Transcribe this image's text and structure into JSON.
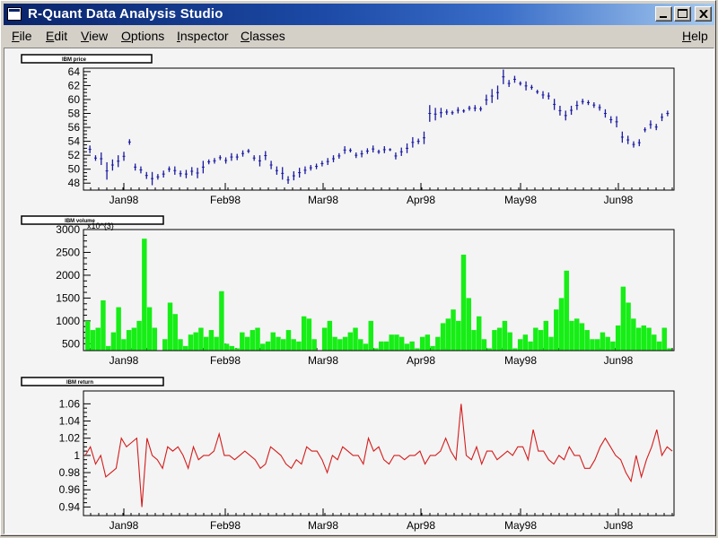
{
  "window": {
    "title": "R-Quant Data Analysis Studio",
    "menu": [
      {
        "name": "File",
        "accel": "F",
        "rest": "ile"
      },
      {
        "name": "Edit",
        "accel": "E",
        "rest": "dit"
      },
      {
        "name": "View",
        "accel": "V",
        "rest": "iew"
      },
      {
        "name": "Options",
        "accel": "O",
        "rest": "ptions"
      },
      {
        "name": "Inspector",
        "accel": "I",
        "rest": "nspector"
      },
      {
        "name": "Classes",
        "accel": "C",
        "rest": "lasses"
      }
    ],
    "help": {
      "accel": "H",
      "rest": "elp"
    }
  },
  "chart_data": [
    {
      "type": "ohlc",
      "title": "IBM price",
      "x_tick_labels": [
        "Jan98",
        "Feb98",
        "Mar98",
        "Apr98",
        "May98",
        "Jun98"
      ],
      "ylim": [
        47,
        64.5
      ],
      "y_ticks": [
        48,
        50,
        52,
        54,
        56,
        58,
        60,
        62,
        64
      ],
      "color": "#1a1aa0",
      "values": [
        [
          52.3,
          53.4
        ],
        [
          51.2,
          52.0
        ],
        [
          50.6,
          52.4
        ],
        [
          48.5,
          51.0
        ],
        [
          49.8,
          51.4
        ],
        [
          50.3,
          52.0
        ],
        [
          51.2,
          52.5
        ],
        [
          53.5,
          54.3
        ],
        [
          49.8,
          50.8
        ],
        [
          49.4,
          50.4
        ],
        [
          48.6,
          49.6
        ],
        [
          47.7,
          49.6
        ],
        [
          48.5,
          49.3
        ],
        [
          48.8,
          49.8
        ],
        [
          49.6,
          50.4
        ],
        [
          49.2,
          50.4
        ],
        [
          48.9,
          49.8
        ],
        [
          48.7,
          49.9
        ],
        [
          49.1,
          50.3
        ],
        [
          48.7,
          50.2
        ],
        [
          49.4,
          51.2
        ],
        [
          50.7,
          51.4
        ],
        [
          50.8,
          51.6
        ],
        [
          51.3,
          52.0
        ],
        [
          50.8,
          51.7
        ],
        [
          51.2,
          52.3
        ],
        [
          51.3,
          52.2
        ],
        [
          51.8,
          52.7
        ],
        [
          52.3,
          52.9
        ],
        [
          51.2,
          52.0
        ],
        [
          50.4,
          52.0
        ],
        [
          51.3,
          52.6
        ],
        [
          50.0,
          51.2
        ],
        [
          49.2,
          50.4
        ],
        [
          48.5,
          50.3
        ],
        [
          47.9,
          49.0
        ],
        [
          48.4,
          49.7
        ],
        [
          48.8,
          50.2
        ],
        [
          49.3,
          50.4
        ],
        [
          49.8,
          50.6
        ],
        [
          50.0,
          50.8
        ],
        [
          50.4,
          51.2
        ],
        [
          50.6,
          51.6
        ],
        [
          51.0,
          52.0
        ],
        [
          51.5,
          52.3
        ],
        [
          52.2,
          53.3
        ],
        [
          52.4,
          53.0
        ],
        [
          51.6,
          52.4
        ],
        [
          51.7,
          52.7
        ],
        [
          52.2,
          53.0
        ],
        [
          52.4,
          53.4
        ],
        [
          52.2,
          52.8
        ],
        [
          52.3,
          53.3
        ],
        [
          52.6,
          53.0
        ],
        [
          51.4,
          52.4
        ],
        [
          51.9,
          53.1
        ],
        [
          52.3,
          53.7
        ],
        [
          53.1,
          54.6
        ],
        [
          53.6,
          54.4
        ],
        [
          53.6,
          55.4
        ],
        [
          56.8,
          59.2
        ],
        [
          57.0,
          58.8
        ],
        [
          57.4,
          58.8
        ],
        [
          57.8,
          58.6
        ],
        [
          57.8,
          58.4
        ],
        [
          58.0,
          58.9
        ],
        [
          58.1,
          58.6
        ],
        [
          58.4,
          59.1
        ],
        [
          58.3,
          59.2
        ],
        [
          58.3,
          59.0
        ],
        [
          59.2,
          60.7
        ],
        [
          59.5,
          61.5
        ],
        [
          60.0,
          62.0
        ],
        [
          62.2,
          64.3
        ],
        [
          61.8,
          62.8
        ],
        [
          62.4,
          63.4
        ],
        [
          62.0,
          62.6
        ],
        [
          61.3,
          62.6
        ],
        [
          61.4,
          62.1
        ],
        [
          60.8,
          61.4
        ],
        [
          60.1,
          61.2
        ],
        [
          60.0,
          61.0
        ],
        [
          58.5,
          60.1
        ],
        [
          57.7,
          59.1
        ],
        [
          57.0,
          58.4
        ],
        [
          57.8,
          59.1
        ],
        [
          58.5,
          59.8
        ],
        [
          59.3,
          60.1
        ],
        [
          59.2,
          59.9
        ],
        [
          58.8,
          59.6
        ],
        [
          58.4,
          59.3
        ],
        [
          57.4,
          58.6
        ],
        [
          56.6,
          57.6
        ],
        [
          56.0,
          57.6
        ],
        [
          53.8,
          55.4
        ],
        [
          53.6,
          54.8
        ],
        [
          53.1,
          54.0
        ],
        [
          53.3,
          54.3
        ],
        [
          55.3,
          56.0
        ],
        [
          55.8,
          57.0
        ],
        [
          55.6,
          56.5
        ],
        [
          56.9,
          58.0
        ],
        [
          57.6,
          58.4
        ]
      ]
    },
    {
      "type": "bar",
      "title": "IBM volume",
      "axis_note": "x10^{3}",
      "x_tick_labels": [
        "Jan98",
        "Feb98",
        "Mar98",
        "Apr98",
        "May98",
        "Jun98"
      ],
      "ylim": [
        350,
        3000
      ],
      "y_ticks": [
        500,
        1000,
        1500,
        2000,
        2500,
        3000
      ],
      "color": "#16ee16",
      "values": [
        1000,
        800,
        850,
        1450,
        450,
        750,
        1300,
        600,
        800,
        850,
        1000,
        2800,
        1300,
        850,
        350,
        600,
        1400,
        1150,
        600,
        450,
        700,
        750,
        850,
        650,
        800,
        650,
        1650,
        500,
        450,
        400,
        750,
        650,
        800,
        850,
        500,
        550,
        750,
        650,
        600,
        800,
        600,
        550,
        1100,
        1050,
        600,
        350,
        850,
        1000,
        650,
        600,
        650,
        750,
        850,
        600,
        500,
        1000,
        400,
        550,
        550,
        700,
        700,
        650,
        500,
        550,
        400,
        650,
        700,
        450,
        650,
        950,
        1050,
        1250,
        1000,
        2450,
        1500,
        800,
        1100,
        600,
        400,
        800,
        850,
        1000,
        750,
        400,
        600,
        700,
        550,
        850,
        800,
        1000,
        650,
        1250,
        1500,
        2100,
        1000,
        1050,
        950,
        800,
        600,
        600,
        750,
        650,
        550,
        900,
        1750,
        1400,
        1050,
        850,
        900,
        850,
        700,
        550,
        850,
        400
      ]
    },
    {
      "type": "line",
      "title": "IBM return",
      "x_tick_labels": [
        "Jan98",
        "Feb98",
        "Mar98",
        "Apr98",
        "May98",
        "Jun98"
      ],
      "ylim": [
        0.93,
        1.075
      ],
      "y_ticks": [
        0.94,
        0.96,
        0.98,
        1,
        1.02,
        1.04,
        1.06
      ],
      "y_tick_labels": [
        "0.94",
        "0.96",
        "0.98",
        "1",
        "1.02",
        "1.04",
        "1.06"
      ],
      "color": "#d41c1c",
      "values": [
        1.0,
        1.01,
        0.99,
        1.0,
        0.975,
        0.98,
        0.985,
        1.02,
        1.01,
        1.015,
        1.02,
        0.94,
        1.02,
        1.0,
        0.995,
        0.985,
        1.01,
        1.005,
        1.01,
        1.0,
        0.985,
        1.01,
        0.995,
        1.0,
        1.0,
        1.005,
        1.025,
        1.0,
        1.0,
        0.995,
        1.0,
        1.005,
        1.0,
        0.995,
        0.985,
        0.99,
        1.01,
        1.005,
        1.0,
        0.99,
        0.985,
        0.995,
        0.99,
        1.01,
        1.005,
        1.005,
        0.995,
        0.98,
        1.0,
        0.995,
        1.01,
        1.005,
        1.0,
        1.0,
        0.99,
        1.02,
        1.005,
        1.01,
        0.995,
        0.99,
        1.0,
        1.0,
        0.995,
        1.0,
        1.0,
        1.005,
        0.99,
        1.0,
        1.0,
        1.005,
        1.02,
        1.005,
        0.995,
        1.06,
        1.0,
        0.995,
        1.01,
        0.99,
        1.005,
        1.005,
        0.995,
        1.0,
        1.005,
        1.0,
        1.01,
        1.01,
        0.995,
        1.03,
        1.005,
        1.005,
        0.995,
        0.99,
        1.0,
        0.995,
        1.01,
        1.0,
        1.0,
        0.985,
        0.985,
        0.995,
        1.01,
        1.02,
        1.01,
        1.0,
        0.995,
        0.98,
        0.97,
        1.0,
        0.975,
        0.995,
        1.01,
        1.03,
        1.0,
        1.01,
        1.005
      ]
    }
  ]
}
